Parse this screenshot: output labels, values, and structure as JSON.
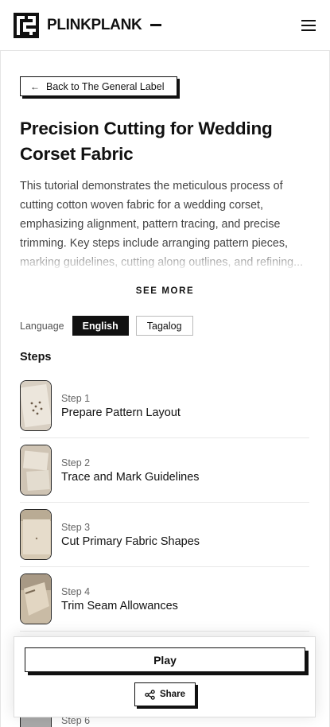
{
  "header": {
    "brand_name": "PLINKPLANK",
    "logo_icon": "plinkplank-logo-icon",
    "menu_icon": "hamburger-menu-icon"
  },
  "back_button": {
    "label": "Back to The General Label",
    "icon": "arrow-left-icon"
  },
  "tutorial": {
    "title": "Precision Cutting for Wedding Corset Fabric",
    "description": "This tutorial demonstrates the meticulous process of cutting cotton woven fabric for a wedding corset, emphasizing alignment, pattern tracing, and precise trimming. Key steps include arranging pattern pieces, marking guidelines, cutting along outlines, and refining..."
  },
  "see_more_label": "SEE MORE",
  "language": {
    "label": "Language",
    "options": [
      "English",
      "Tagalog"
    ],
    "selected": "English"
  },
  "steps_heading": "Steps",
  "steps": [
    {
      "number": "Step 1",
      "title": "Prepare Pattern Layout"
    },
    {
      "number": "Step 2",
      "title": "Trace and Mark Guidelines"
    },
    {
      "number": "Step 3",
      "title": "Cut Primary Fabric Shapes"
    },
    {
      "number": "Step 4",
      "title": "Trim Seam Allowances"
    },
    {
      "number": "Step 6",
      "title": ""
    }
  ],
  "actions": {
    "play_label": "Play",
    "share_label": "Share",
    "share_icon": "share-icon"
  },
  "colors": {
    "primary": "#111111",
    "background": "#ffffff",
    "muted_text": "#444444"
  }
}
